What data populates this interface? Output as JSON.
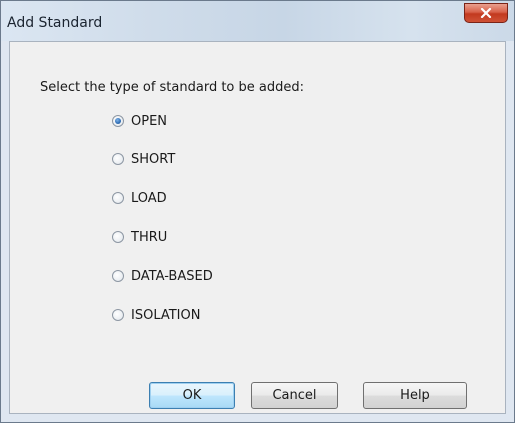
{
  "window": {
    "title": "Add Standard",
    "close_icon": "close-icon"
  },
  "dialog": {
    "prompt": "Select the type of standard to be added:",
    "selected": "OPEN",
    "options": [
      {
        "label": "OPEN",
        "checked": true
      },
      {
        "label": "SHORT",
        "checked": false
      },
      {
        "label": "LOAD",
        "checked": false
      },
      {
        "label": "THRU",
        "checked": false
      },
      {
        "label": "DATA-BASED",
        "checked": false
      },
      {
        "label": "ISOLATION",
        "checked": false
      }
    ]
  },
  "buttons": {
    "ok": "OK",
    "cancel": "Cancel",
    "help": "Help"
  },
  "colors": {
    "close_button": "#c2391f",
    "default_button_border": "#3c7fb1",
    "radio_selected": "#2f6db5"
  }
}
